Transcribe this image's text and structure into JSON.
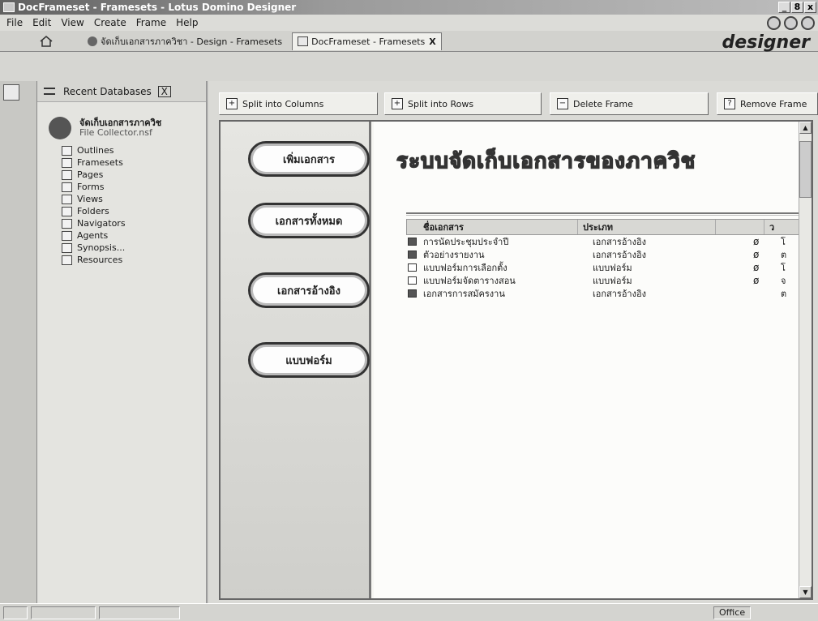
{
  "window": {
    "title": "DocFrameset - Framesets - Lotus Domino Designer",
    "controls": [
      "_",
      "8",
      "x"
    ]
  },
  "menu": [
    "File",
    "Edit",
    "View",
    "Create",
    "Frame",
    "Help"
  ],
  "tabs": [
    {
      "label": "จัดเก็บเอกสารภาควิชา - Design - Framesets"
    },
    {
      "label": "DocFrameset - Framesets",
      "close": "X"
    }
  ],
  "brand": "designer",
  "navigator": {
    "header": "Recent Databases",
    "close": "X",
    "db_title": "จัดเก็บเอกสารภาควิช",
    "db_file": "File Collector.nsf",
    "items": [
      "Outlines",
      "Framesets",
      "Pages",
      "Forms",
      "Views",
      "Folders",
      "Navigators",
      "Agents",
      "Synopsis...",
      "Resources"
    ]
  },
  "actions": [
    "Split into Columns",
    "Split into Rows",
    "Delete Frame",
    "Remove Frame"
  ],
  "left_frame_buttons": [
    "เพิ่มเอกสาร",
    "เอกสารทั้งหมด",
    "เอกสารอ้างอิง",
    "แบบฟอร์ม"
  ],
  "banner": "ระบบจัดเก็บเอกสารของภาควิช",
  "view": {
    "columns": [
      "ชื่อเอกสาร",
      "ประเภท",
      "ว"
    ],
    "rows": [
      {
        "name": "การนัดประชุมประจำปี",
        "type": "เอกสารอ้างอิง",
        "attach": "ø",
        "more": "โ",
        "kind": "doc"
      },
      {
        "name": "ตัวอย่างรายงาน",
        "type": "เอกสารอ้างอิง",
        "attach": "ø",
        "more": "ต",
        "kind": "doc"
      },
      {
        "name": "แบบฟอร์มการเลือกตั้ง",
        "type": "แบบฟอร์ม",
        "attach": "ø",
        "more": "โ",
        "kind": "form"
      },
      {
        "name": "แบบฟอร์มจัดตารางสอน",
        "type": "แบบฟอร์ม",
        "attach": "ø",
        "more": "จ",
        "kind": "form"
      },
      {
        "name": "เอกสารการสมัครงาน",
        "type": "เอกสารอ้างอิง",
        "attach": "",
        "more": "ต",
        "kind": "doc"
      }
    ]
  },
  "status": {
    "office": "Office"
  }
}
